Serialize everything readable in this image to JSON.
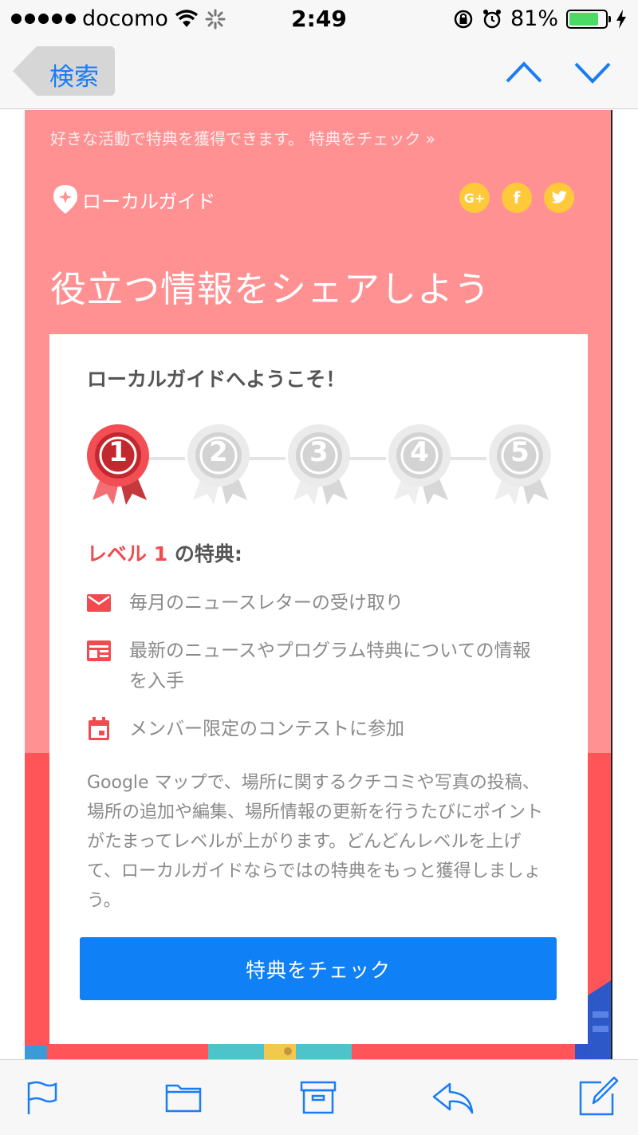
{
  "status_bar": {
    "carrier": "docomo",
    "time": "2:49",
    "battery": "81%",
    "battery_level": 0.81,
    "icons": [
      "signal-dots-icon",
      "wifi-icon",
      "activity-spinner-icon",
      "rotation-lock-icon",
      "alarm-icon",
      "battery-icon",
      "charging-bolt-icon"
    ]
  },
  "nav": {
    "back_label": "検索",
    "icons": [
      "chevron-up-icon",
      "chevron-down-icon"
    ]
  },
  "email": {
    "promo_text": "好きな活動で特典を獲得できます。 特典をチェック »",
    "brand_name": "ローカルガイド",
    "social": [
      {
        "name": "google-plus-icon",
        "label": "G+"
      },
      {
        "name": "facebook-icon",
        "label": "f"
      },
      {
        "name": "twitter-icon",
        "label": ""
      }
    ],
    "headline": "役立つ情報をシェアしよう",
    "card": {
      "welcome": "ローカルガイドへようこそ！",
      "levels": [
        "1",
        "2",
        "3",
        "4",
        "5"
      ],
      "current_level": 1,
      "level_prefix": "レベル 1",
      "level_suffix": " の特典:",
      "benefits": [
        {
          "icon": "mail-icon",
          "text": "毎月のニュースレターの受け取り"
        },
        {
          "icon": "newsletter-icon",
          "text": "最新のニュースやプログラム特典についての情報を入手"
        },
        {
          "icon": "calendar-icon",
          "text": "メンバー限定のコンテストに参加"
        }
      ],
      "description": "Google マップで、場所に関するクチコミや写真の投稿、場所の追加や編集、場所情報の更新を行うたびにポイントがたまってレベルが上がります。どんどんレベルを上げて、ローカルガイドならではの特典をもっと獲得しましょう。",
      "cta_label": "特典をチェック"
    },
    "colors": {
      "header_bg": "#ff9193",
      "band_bg": "#ff5558",
      "accent": "#f14b50",
      "cta": "#0f80f5",
      "social": "#ffc93a"
    }
  },
  "toolbar": {
    "icons": [
      "flag-icon",
      "folder-icon",
      "archive-icon",
      "reply-icon",
      "compose-icon"
    ]
  }
}
